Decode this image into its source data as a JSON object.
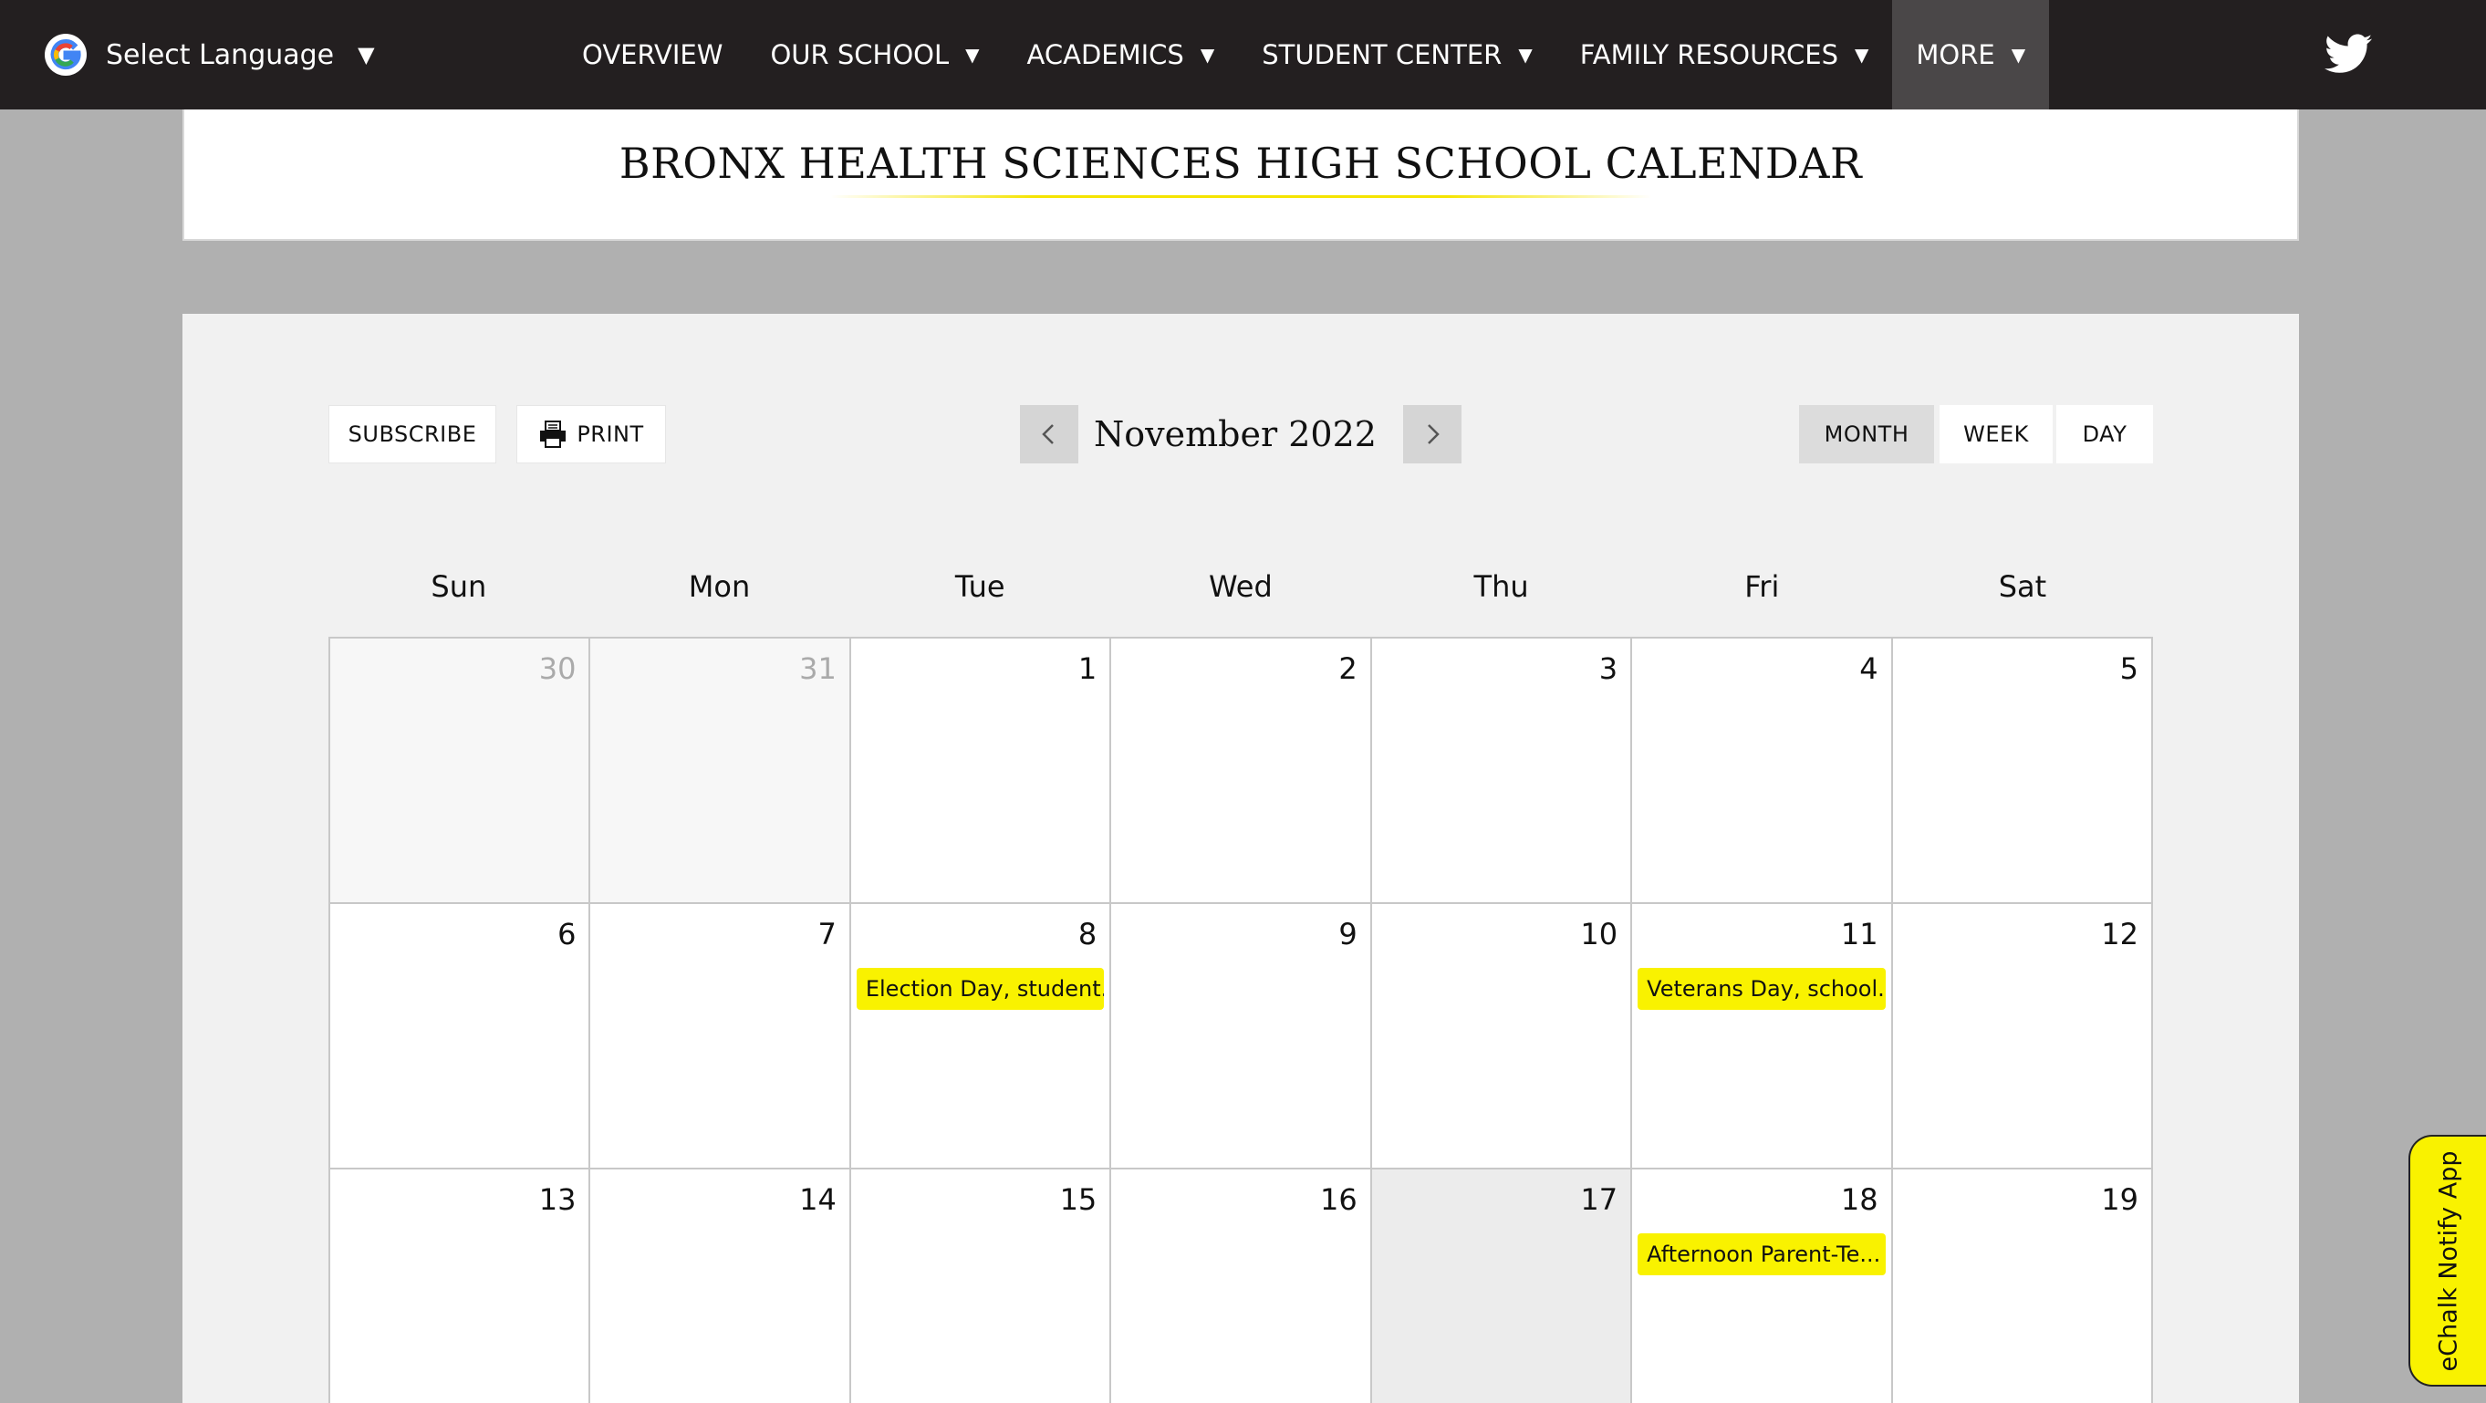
{
  "nav": {
    "language_label": "Select Language",
    "language_caret": "▼",
    "items": [
      {
        "label": "OVERVIEW",
        "caret": ""
      },
      {
        "label": "OUR SCHOOL",
        "caret": "▼"
      },
      {
        "label": "ACADEMICS",
        "caret": "▼"
      },
      {
        "label": "STUDENT CENTER",
        "caret": "▼"
      },
      {
        "label": "FAMILY RESOURCES",
        "caret": "▼"
      },
      {
        "label": "MORE",
        "caret": "▼"
      }
    ],
    "social_icon": "twitter-icon"
  },
  "header": {
    "title": "BRONX HEALTH SCIENCES HIGH SCHOOL CALENDAR",
    "accent_color": "#f5e400"
  },
  "toolbar": {
    "subscribe_label": "SUBSCRIBE",
    "print_label": "PRINT",
    "month_label": "November 2022",
    "views": [
      "MONTH",
      "WEEK",
      "DAY"
    ],
    "active_view": "MONTH"
  },
  "calendar": {
    "weekdays": [
      "Sun",
      "Mon",
      "Tue",
      "Wed",
      "Thu",
      "Fri",
      "Sat"
    ],
    "days": [
      {
        "num": "30",
        "other": true
      },
      {
        "num": "31",
        "other": true
      },
      {
        "num": "1"
      },
      {
        "num": "2"
      },
      {
        "num": "3"
      },
      {
        "num": "4"
      },
      {
        "num": "5"
      },
      {
        "num": "6"
      },
      {
        "num": "7"
      },
      {
        "num": "8",
        "event": "Election Day, student..."
      },
      {
        "num": "9"
      },
      {
        "num": "10"
      },
      {
        "num": "11",
        "event": "Veterans Day, school..."
      },
      {
        "num": "12"
      },
      {
        "num": "13"
      },
      {
        "num": "14"
      },
      {
        "num": "15"
      },
      {
        "num": "16"
      },
      {
        "num": "17",
        "today": true
      },
      {
        "num": "18",
        "event": "Afternoon Parent-Te..."
      },
      {
        "num": "19"
      }
    ],
    "event_color": "#f9f200"
  },
  "echalk": {
    "label": "eChalk Notify App"
  }
}
